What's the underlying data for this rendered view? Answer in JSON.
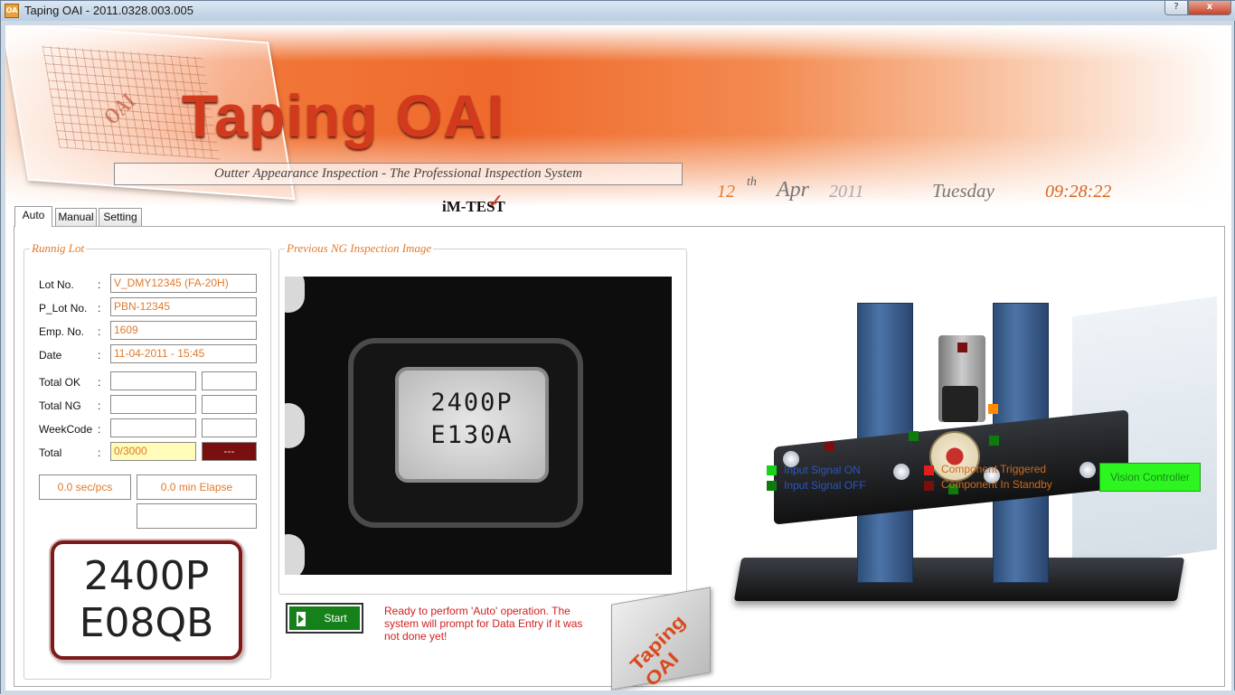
{
  "window": {
    "title": "Taping OAI - 2011.0328.003.005",
    "app_icon": "app-logo-icon",
    "help_label": "?",
    "close_label": "x"
  },
  "banner": {
    "app_title": "Taping OAI",
    "subtitle": "Outter Appearance Inspection - The Professional Inspection System",
    "brand": "iM-TEST",
    "glass_logo": "OAI"
  },
  "datetime": {
    "day": "12",
    "day_suffix": "th",
    "month": "Apr",
    "year": "2011",
    "weekday": "Tuesday",
    "time": "09:28:22"
  },
  "tabs": [
    {
      "label": "Auto",
      "active": true
    },
    {
      "label": "Manual",
      "active": false
    },
    {
      "label": "Setting",
      "active": false
    }
  ],
  "running_lot": {
    "title": "Runnig Lot",
    "lot_no_label": "Lot No.",
    "lot_no": "V_DMY12345   (FA-20H)",
    "p_lot_no_label": "P_Lot No.",
    "p_lot_no": "PBN-12345",
    "emp_no_label": "Emp. No.",
    "emp_no": "1609",
    "date_label": "Date",
    "date": "11-04-2011 - 15:45",
    "total_ok_label": "Total OK",
    "total_ng_label": "Total NG",
    "weekcode_label": "WeekCode",
    "total_label": "Total",
    "total_value": "0/3000",
    "total_status": "---",
    "speed": "0.0 sec/pcs",
    "elapsed": "0.0 min Elapse",
    "colon": ":",
    "part_line1": "2400P",
    "part_line2": "E08QB"
  },
  "ng_image": {
    "title": "Previous NG Inspection Image",
    "chip_line1": "2400P",
    "chip_line2": "E130A"
  },
  "controls": {
    "start_label": "Start",
    "status_message": "Ready to perform 'Auto' operation. The system will prompt for Data Entry if it was not done yet!",
    "tile_text": "Taping OAI"
  },
  "legend": {
    "input_on": "Input Signal ON",
    "input_off": "Input Signal OFF",
    "triggered": "Component Triggered",
    "standby": "Component In Standby"
  },
  "colors": {
    "input_on": "#18d118",
    "input_off": "#0c7c0c",
    "triggered": "#e21e1e",
    "standby": "#7a0f0f",
    "accent": "#e07a2c"
  },
  "vision_button": "Vision Controller"
}
